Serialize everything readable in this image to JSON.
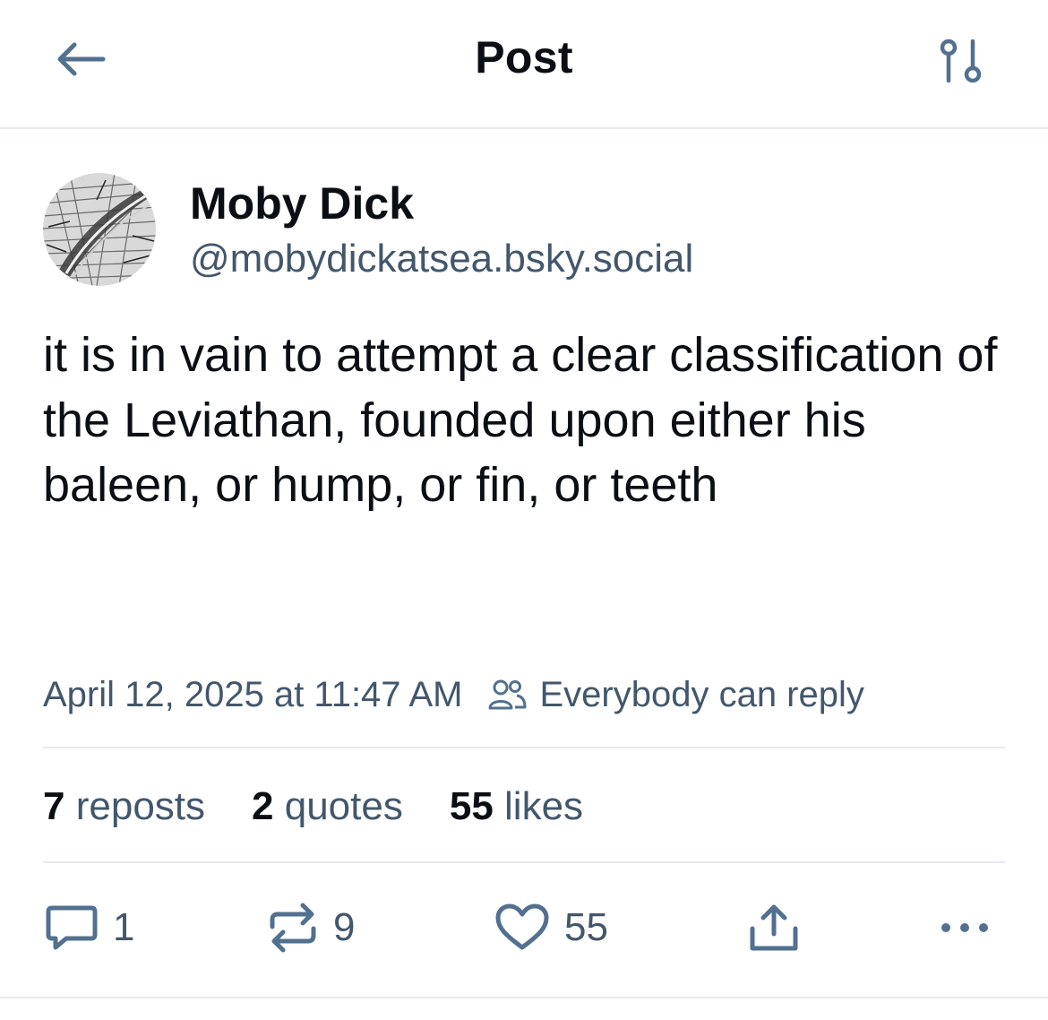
{
  "header": {
    "title": "Post",
    "back_icon": "arrow-left-icon",
    "filter_icon": "sliders-icon"
  },
  "author": {
    "display_name": "Moby Dick",
    "handle": "@mobydickatsea.bsky.social",
    "avatar_icon": "whale-engraving-avatar"
  },
  "post": {
    "text": "it is in vain to attempt a clear classification of the Leviathan, founded upon either his baleen, or hump, or fin, or teeth",
    "timestamp": "April 12, 2025 at 11:47 AM",
    "reply_setting": "Everybody can reply"
  },
  "stats": {
    "reposts_count": "7",
    "reposts_label": "reposts",
    "quotes_count": "2",
    "quotes_label": "quotes",
    "likes_count": "55",
    "likes_label": "likes"
  },
  "actions": {
    "reply_count": "1",
    "repost_count": "9",
    "like_count": "55"
  },
  "colors": {
    "text": "#0b0f14",
    "muted": "#42576c",
    "icon": "#52708f",
    "divider": "#e6e9ee"
  }
}
